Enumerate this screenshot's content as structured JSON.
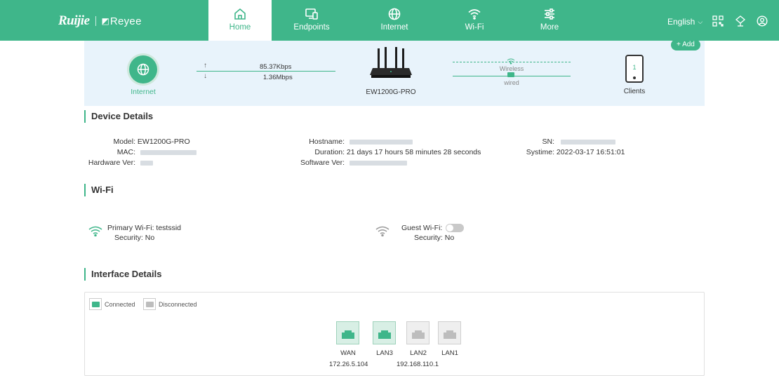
{
  "brand": {
    "ruijie": "Ruijie",
    "reyee": "Reyee"
  },
  "nav": [
    {
      "label": "Home",
      "icon": "home-icon",
      "active": true
    },
    {
      "label": "Endpoints",
      "icon": "endpoints-icon",
      "active": false
    },
    {
      "label": "Internet",
      "icon": "globe-icon",
      "active": false
    },
    {
      "label": "Wi-Fi",
      "icon": "wifi-icon",
      "active": false
    },
    {
      "label": "More",
      "icon": "sliders-icon",
      "active": false
    }
  ],
  "header_right": {
    "language": "English",
    "icons": [
      "qr-code-icon",
      "network-icon",
      "user-icon"
    ]
  },
  "topology": {
    "internet_label": "Internet",
    "upload_rate": "85.37Kbps",
    "download_rate": "1.36Mbps",
    "device_name": "EW1200G-PRO",
    "wireless_label": "Wireless",
    "wired_label": "wired",
    "clients_count": "1",
    "clients_label": "Clients",
    "add_button": "+ Add"
  },
  "device_details": {
    "title": "Device Details",
    "model_label": "Model:",
    "model_value": "EW1200G-PRO",
    "mac_label": "MAC:",
    "hardware_label": "Hardware Ver:",
    "hostname_label": "Hostname:",
    "duration_label": "Duration:",
    "duration_value": "21 days 17 hours 58 minutes 28 seconds",
    "software_label": "Software Ver:",
    "sn_label": "SN:",
    "systime_label": "Systime:",
    "systime_value": "2022-03-17 16:51:01"
  },
  "wifi": {
    "title": "Wi-Fi",
    "primary_label": "Primary Wi-Fi:",
    "primary_ssid": "testssid",
    "primary_security_label": "Security:",
    "primary_security": "No",
    "guest_label": "Guest Wi-Fi:",
    "guest_enabled": false,
    "guest_security_label": "Security:",
    "guest_security": "No"
  },
  "interface_details": {
    "title": "Interface Details",
    "legend_connected": "Connected",
    "legend_disconnected": "Disconnected",
    "ports": [
      {
        "name": "WAN",
        "status": "connected",
        "ip": "172.26.5.104"
      },
      {
        "name": "LAN3",
        "status": "connected",
        "ip": ""
      },
      {
        "name": "LAN2",
        "status": "disconnected",
        "ip": ""
      },
      {
        "name": "LAN1",
        "status": "disconnected",
        "ip": ""
      }
    ],
    "lan_ip": "192.168.110.1"
  },
  "colors": {
    "brand_green": "#3fb68a",
    "topology_bg": "#e8f3fb",
    "port_disconnected": "#bdbdbd"
  }
}
